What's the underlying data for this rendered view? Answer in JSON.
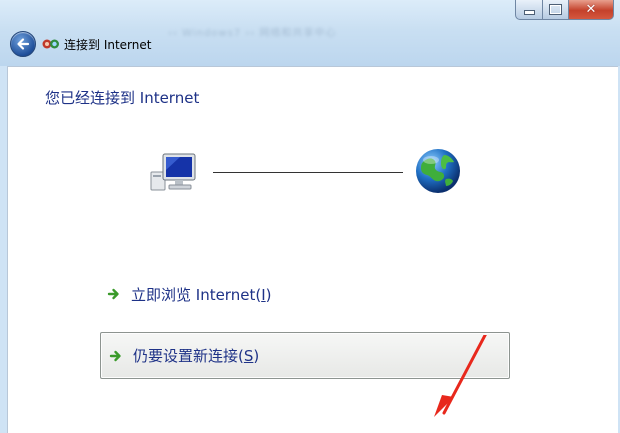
{
  "window": {
    "title": "连接到 Internet",
    "breadcrumb_faded": "‹‹ Windows7 ›› 网络和共享中心"
  },
  "page": {
    "heading": "您已经连接到 Internet"
  },
  "tasks": {
    "browse": {
      "label": "立即浏览 Internet(",
      "accel": "I",
      "suffix": ")"
    },
    "new_connection": {
      "label": "仍要设置新连接(",
      "accel": "S",
      "suffix": ")"
    }
  },
  "colors": {
    "heading": "#1e3287",
    "link": "#1e3287",
    "annotation_arrow": "#e8281c",
    "task_arrow": "#3a9a2a"
  },
  "icons": {
    "back": "back-arrow-icon",
    "wizard": "network-wizard-icon",
    "computer": "computer-icon",
    "globe": "globe-icon",
    "task_arrow": "green-arrow-icon"
  }
}
